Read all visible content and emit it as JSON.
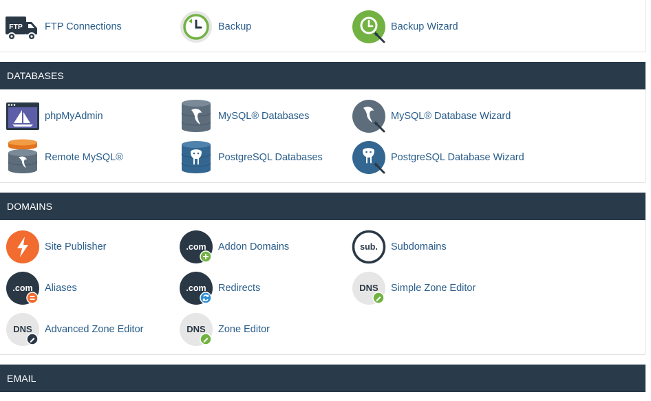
{
  "files": {
    "items": [
      {
        "label": "FTP Connections",
        "icon": "ftp-truck-icon"
      },
      {
        "label": "Backup",
        "icon": "backup-clock-icon"
      },
      {
        "label": "Backup Wizard",
        "icon": "backup-wizard-icon"
      }
    ]
  },
  "databases": {
    "title": "DATABASES",
    "items": [
      {
        "label": "phpMyAdmin",
        "icon": "phpmyadmin-icon"
      },
      {
        "label": "MySQL® Databases",
        "icon": "mysql-databases-icon"
      },
      {
        "label": "MySQL® Database Wizard",
        "icon": "mysql-wizard-icon"
      },
      {
        "label": "Remote MySQL®",
        "icon": "remote-mysql-icon"
      },
      {
        "label": "PostgreSQL Databases",
        "icon": "postgresql-databases-icon"
      },
      {
        "label": "PostgreSQL Database Wizard",
        "icon": "postgresql-wizard-icon"
      }
    ]
  },
  "domains": {
    "title": "DOMAINS",
    "items": [
      {
        "label": "Site Publisher",
        "icon": "site-publisher-icon"
      },
      {
        "label": "Addon Domains",
        "icon": "addon-domains-icon",
        "badge_text": ".com"
      },
      {
        "label": "Subdomains",
        "icon": "subdomains-icon",
        "badge_text": "sub."
      },
      {
        "label": "Aliases",
        "icon": "aliases-icon",
        "badge_text": ".com"
      },
      {
        "label": "Redirects",
        "icon": "redirects-icon",
        "badge_text": ".com"
      },
      {
        "label": "Simple Zone Editor",
        "icon": "simple-zone-editor-icon",
        "badge_text": "DNS"
      },
      {
        "label": "Advanced Zone Editor",
        "icon": "advanced-zone-editor-icon",
        "badge_text": "DNS"
      },
      {
        "label": "Zone Editor",
        "icon": "zone-editor-icon",
        "badge_text": "DNS"
      }
    ]
  },
  "email": {
    "title": "EMAIL"
  },
  "icon_text": {
    "ftp": "FTP"
  },
  "colors": {
    "header_bg": "#293a4a",
    "link": "#295d8a",
    "green": "#72b243",
    "orange": "#f26b2f",
    "navy": "#2a3846",
    "db_gray": "#5d6d7c",
    "pg_blue": "#336791"
  }
}
